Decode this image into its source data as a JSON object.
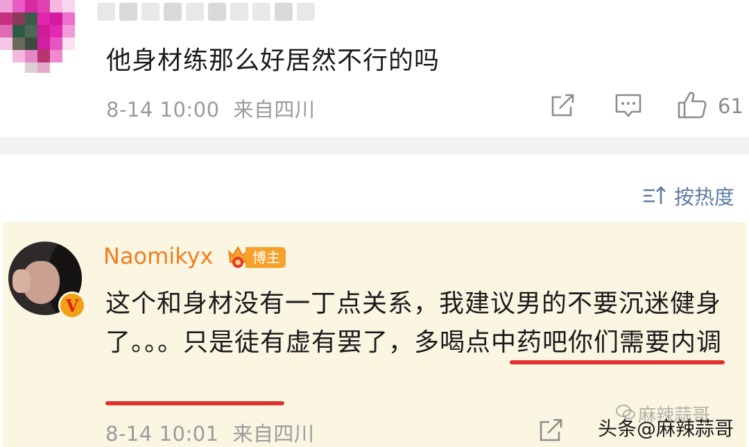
{
  "top_comment": {
    "text": "他身材练那么好居然不行的吗",
    "date": "8-14 10:00",
    "location": "来自四川",
    "like_count": "61",
    "icons": {
      "share": "share-icon",
      "comment": "comment-icon",
      "like": "like-icon"
    }
  },
  "sort": {
    "label": "按热度",
    "icon": "sort-icon"
  },
  "highlight_comment": {
    "username": "Naomikyx",
    "badge": "博主",
    "verified_mark": "V",
    "text": "这个和身材没有一丁点关系，我建议男的不要沉迷健身了。。。只是徒有虚有罢了，多喝点中药吧你们需要内调",
    "date": "8-14 10:01",
    "location": "来自四川"
  },
  "watermark": {
    "source": "头条",
    "account": "@麻辣蒜哥",
    "faded": "麻辣蒜哥"
  },
  "colors": {
    "accent_orange": "#f07e1e",
    "underline_red": "#e03030",
    "highlight_bg": "#fbf6e2",
    "sort_blue": "#5b7aa3"
  }
}
